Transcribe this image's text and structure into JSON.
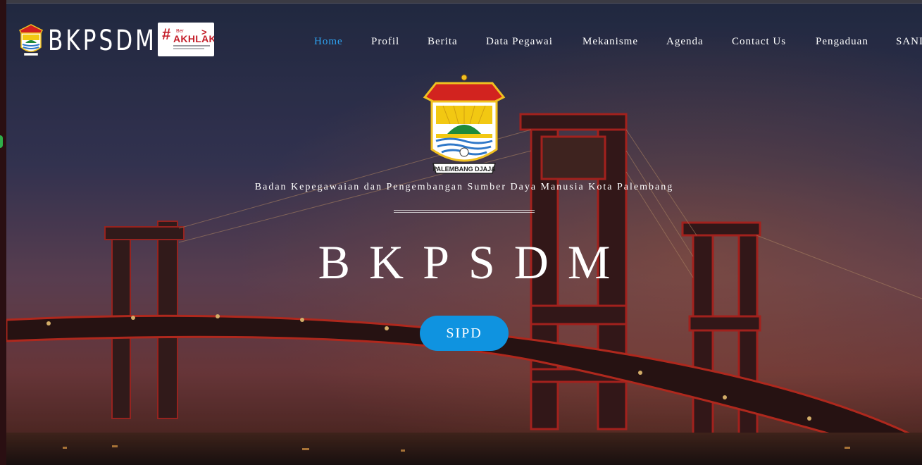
{
  "brand": {
    "name": "BKPSDM",
    "emblem_icon": "palembang-emblem-icon",
    "badge": {
      "hash": "#",
      "ber": "Ber",
      "word": "AKHLAK",
      "arrow": ">"
    }
  },
  "nav": {
    "items": [
      {
        "label": "Home",
        "active": true
      },
      {
        "label": "Profil",
        "active": false
      },
      {
        "label": "Berita",
        "active": false
      },
      {
        "label": "Data Pegawai",
        "active": false
      },
      {
        "label": "Mekanisme",
        "active": false
      },
      {
        "label": "Agenda",
        "active": false
      },
      {
        "label": "Contact Us",
        "active": false
      },
      {
        "label": "Pengaduan",
        "active": false
      },
      {
        "label": "SANI",
        "active": false
      }
    ],
    "active_color": "#2ea3f2"
  },
  "hero": {
    "emblem_ribbon": "PALEMBANG DJAJA",
    "subtitle": "Badan Kepegawaian dan Pengembangan Sumber Daya Manusia Kota Palembang",
    "title": "BKPSDM",
    "cta_label": "SIPD",
    "cta_color": "#0f93e0",
    "background": "ampera-bridge-night-photo"
  }
}
